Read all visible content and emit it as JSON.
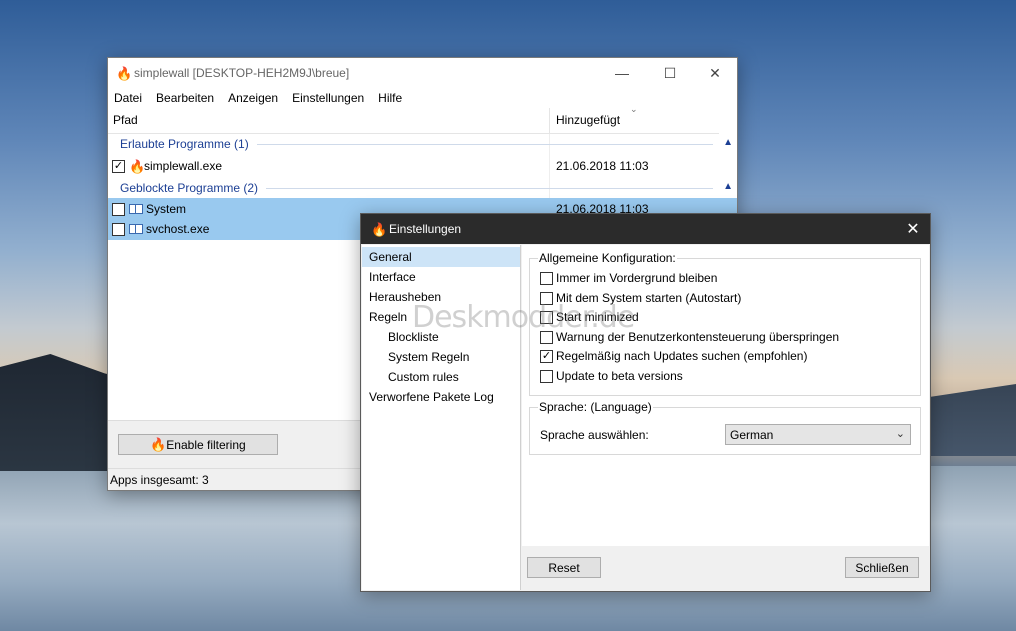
{
  "main_window": {
    "title": "simplewall [DESKTOP-HEH2M9J\\breue]",
    "menu": [
      "Datei",
      "Bearbeiten",
      "Anzeigen",
      "Einstellungen",
      "Hilfe"
    ],
    "columns": [
      "Pfad",
      "Hinzugefügt"
    ],
    "groups": [
      {
        "label": "Erlaubte Programme (1)",
        "items": [
          {
            "name": "simplewall.exe",
            "date": "21.06.2018 11:03",
            "checked": true
          }
        ]
      },
      {
        "label": "Geblockte Programme (2)",
        "items": [
          {
            "name": "System",
            "date": "21.06.2018 11:03",
            "checked": false
          },
          {
            "name": "svchost.exe",
            "date": "",
            "checked": false
          }
        ]
      }
    ],
    "enable_button": "Enable filtering",
    "status": "Apps insgesamt: 3"
  },
  "settings": {
    "title": "Einstellungen",
    "nav": [
      {
        "label": "General",
        "sub": false,
        "active": true
      },
      {
        "label": "Interface",
        "sub": false
      },
      {
        "label": "Herausheben",
        "sub": false
      },
      {
        "label": "Regeln",
        "sub": false
      },
      {
        "label": "Blockliste",
        "sub": true
      },
      {
        "label": "System Regeln",
        "sub": true
      },
      {
        "label": "Custom rules",
        "sub": true
      },
      {
        "label": "Verworfene Pakete Log",
        "sub": false
      }
    ],
    "general_group": "Allgemeine Konfiguration:",
    "options": [
      {
        "label": "Immer im Vordergrund bleiben",
        "checked": false
      },
      {
        "label": "Mit dem System starten (Autostart)",
        "checked": false
      },
      {
        "label": "Start minimized",
        "checked": false
      },
      {
        "label": "Warnung der Benutzerkontensteuerung überspringen",
        "checked": false
      },
      {
        "label": "Regelmäßig nach Updates suchen (empfohlen)",
        "checked": true
      },
      {
        "label": "Update to beta versions",
        "checked": false
      }
    ],
    "language_group": "Sprache: (Language)",
    "language_label": "Sprache auswählen:",
    "language_value": "German",
    "reset_button": "Reset",
    "close_button": "Schließen"
  },
  "watermark": "Deskmodder.de"
}
